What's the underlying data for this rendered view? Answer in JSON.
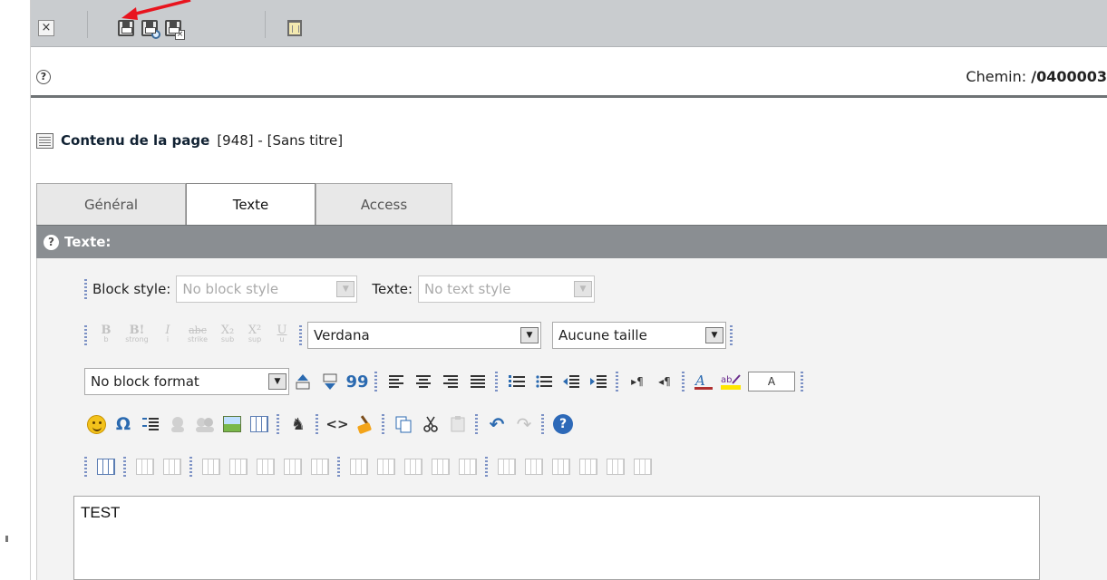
{
  "toolbar": {
    "close_symbol": "×",
    "icons": [
      "save-icon",
      "save-and-view-icon",
      "save-and-close-icon",
      "delete-icon"
    ]
  },
  "info": {
    "help_symbol": "?",
    "path_label": "Chemin:",
    "path_value": "/0400003"
  },
  "content": {
    "title": "Contenu de la page",
    "meta": "[948] - [Sans titre]"
  },
  "tabs": [
    {
      "label": "Général",
      "active": false
    },
    {
      "label": "Texte",
      "active": true
    },
    {
      "label": "Access",
      "active": false
    }
  ],
  "section": {
    "help_symbol": "?",
    "title": "Texte:"
  },
  "editor": {
    "block_style_label": "Block style:",
    "block_style_value": "No block style",
    "text_style_label": "Texte:",
    "text_style_value": "No text style",
    "font_value": "Verdana",
    "size_value": "Aucune taille",
    "block_format_value": "No block format",
    "color_box": "A",
    "buttons_row2": [
      {
        "glyph": "B",
        "sub": "b"
      },
      {
        "glyph": "B!",
        "sub": "strong"
      },
      {
        "glyph": "I",
        "sub": "i"
      },
      {
        "glyph": "abc",
        "sub": "strike"
      },
      {
        "glyph": "X₂",
        "sub": "sub"
      },
      {
        "glyph": "X²",
        "sub": "sup"
      },
      {
        "glyph": "U",
        "sub": "u"
      }
    ],
    "glyphs": {
      "quote": "99",
      "pilcrow_ltr": "▸¶",
      "pilcrow_rtl": "◂¶",
      "omega": "Ω",
      "find": "♞",
      "code": "<>",
      "undo": "↶",
      "redo": "↷",
      "help": "?"
    },
    "content_text": "TEST"
  },
  "colors": {
    "topbar": "#c9cccf",
    "section_header": "#8a8e92",
    "accent_blue": "#2d69b8",
    "annotation_arrow": "#e8141e"
  }
}
